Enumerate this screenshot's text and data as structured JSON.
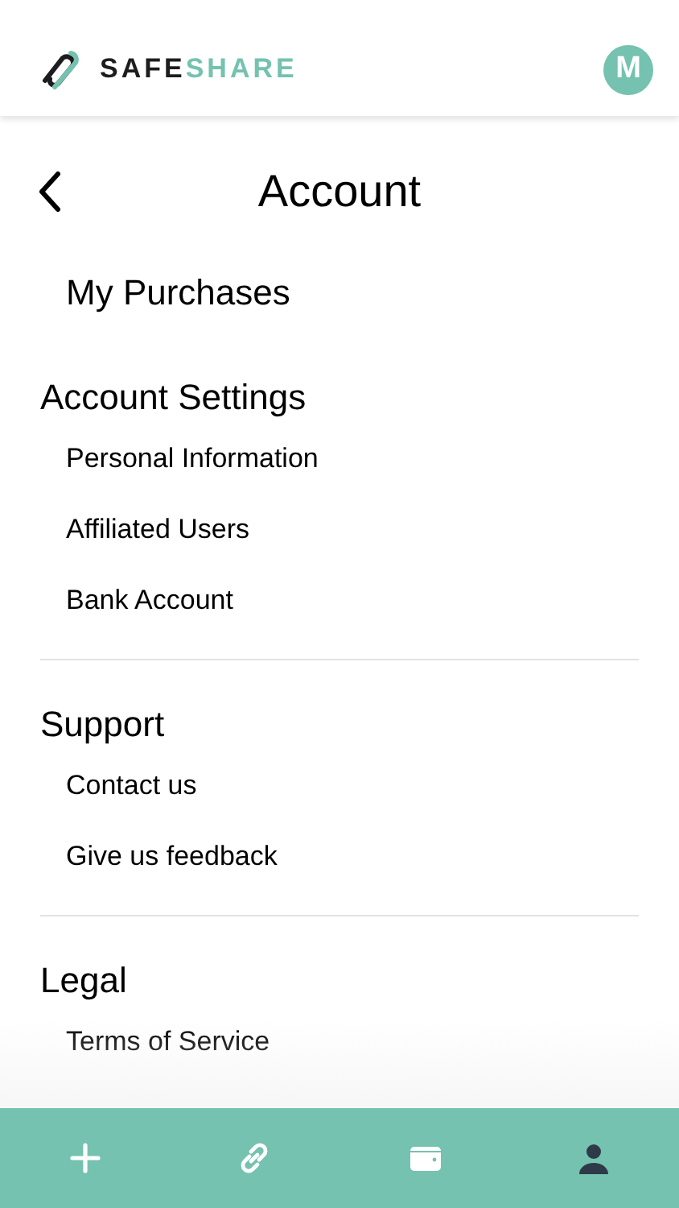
{
  "header": {
    "logo_dark": "SAFE",
    "logo_accent": "SHARE",
    "avatar": "M"
  },
  "title": "Account",
  "top_link": "My Purchases",
  "sections": [
    {
      "title": "Account Settings",
      "items": [
        "Personal Information",
        "Affiliated Users",
        "Bank Account"
      ]
    },
    {
      "title": "Support",
      "items": [
        "Contact us",
        "Give us feedback"
      ]
    },
    {
      "title": "Legal",
      "items": [
        "Terms of Service"
      ]
    }
  ],
  "tab_bar": [
    {
      "kind": "add",
      "selected": false
    },
    {
      "kind": "link",
      "selected": false
    },
    {
      "kind": "wallet",
      "selected": false
    },
    {
      "kind": "person",
      "selected": true
    }
  ]
}
